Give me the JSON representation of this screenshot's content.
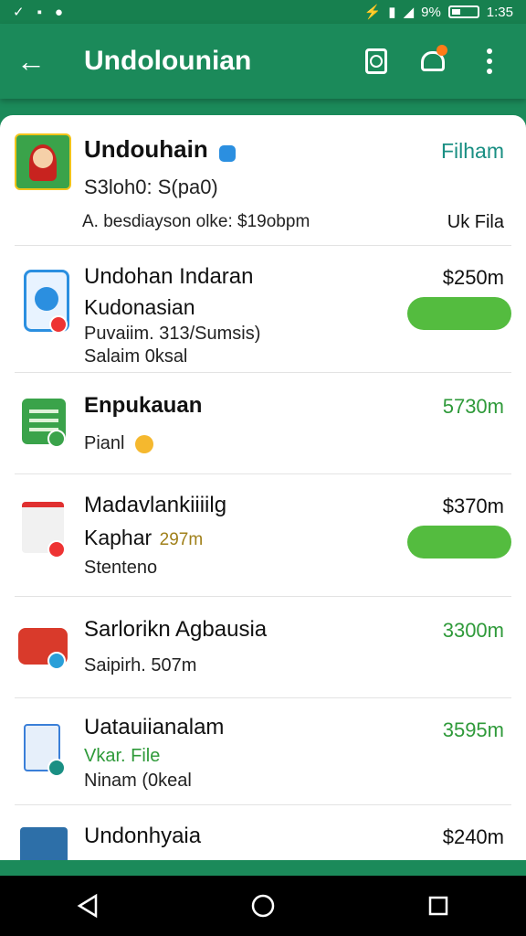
{
  "status": {
    "time": "1:35",
    "battery": "9%"
  },
  "appbar": {
    "title": "Undolounian"
  },
  "profile": {
    "name": "Undouhain",
    "handle": "S3loh0: S(pa0)",
    "detail": "A. besdiayson olke: $19obpm",
    "action": "Filham",
    "meta": "Uk Fila"
  },
  "items": [
    {
      "name": "Undohan Indaran",
      "line2": "Kudonasian",
      "line3": "Puvaiim. 313/Sumsis)",
      "line4": "Salaim 0ksal",
      "amount": "$250m"
    },
    {
      "name": "Enpukauan",
      "line2": "Pianl",
      "amount": "5730m"
    },
    {
      "name": "Madavlankiiiilg",
      "line2": "Kaphar",
      "line2b": "297m",
      "line3": "Stenteno",
      "amount": "$370m"
    },
    {
      "name": "Sarlorikn Agbausia",
      "line2": "Saipirh. 507m",
      "amount": "3300m"
    },
    {
      "name": "Uatauiianalam",
      "line2": "Vkar. File",
      "line3": "Ninam (0keal",
      "amount": "3595m"
    },
    {
      "name": "Undonhyaia",
      "amount": "$240m"
    }
  ],
  "colors": {
    "brand": "#1b8a5a",
    "pill": "#54bc3f",
    "amount_green": "#2f9a3a"
  }
}
